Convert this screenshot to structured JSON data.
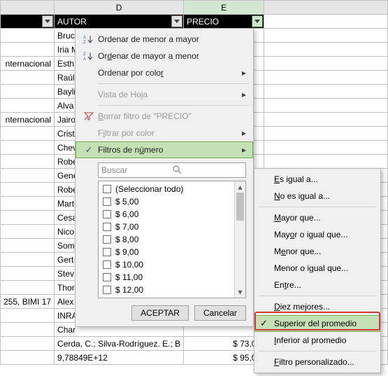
{
  "columns": {
    "c_letter": "",
    "d_letter": "D",
    "e_letter": "E"
  },
  "headers": {
    "autor": "AUTOR",
    "precio": "PRECIO"
  },
  "rows": [
    {
      "c": "",
      "d": "Bruc",
      "e": ""
    },
    {
      "c": "",
      "d": "Iria M",
      "e": ""
    },
    {
      "c": "nternacional",
      "d": "Esth",
      "e": ""
    },
    {
      "c": "",
      "d": "Raúl",
      "e": ""
    },
    {
      "c": "",
      "d": "Bayli",
      "e": ""
    },
    {
      "c": "",
      "d": "Alva",
      "e": ""
    },
    {
      "c": "nternacional",
      "d": "Jairo",
      "e": ""
    },
    {
      "c": "",
      "d": "Crist",
      "e": ""
    },
    {
      "c": "",
      "d": "Chev",
      "e": ""
    },
    {
      "c": "",
      "d": "Robe",
      "e": ""
    },
    {
      "c": "",
      "d": "Gene",
      "e": ""
    },
    {
      "c": "",
      "d": "Robe",
      "e": ""
    },
    {
      "c": "",
      "d": "Mart",
      "e": ""
    },
    {
      "c": "",
      "d": "Cesa",
      "e": ""
    },
    {
      "c": "",
      "d": "Nico",
      "e": ""
    },
    {
      "c": "",
      "d": "Som",
      "e": ""
    },
    {
      "c": "",
      "d": "Gert",
      "e": ""
    },
    {
      "c": "",
      "d": "Stev",
      "e": ""
    },
    {
      "c": "",
      "d": "Thor",
      "e": ""
    },
    {
      "c": "255, BIMI 17",
      "d": "Alex",
      "e": ""
    },
    {
      "c": "",
      "d": "INRA",
      "e": ""
    },
    {
      "c": "",
      "d": "Char",
      "e": ""
    },
    {
      "c": "",
      "d": "Cerda, C.; Silva-Rodríguez. E.; B",
      "e": "$ 73,00"
    },
    {
      "c": "",
      "d": "9,78849E+12",
      "e": "$ 95,00"
    }
  ],
  "menu": {
    "sort_asc": "Ordenar de menor a mayor",
    "sort_desc": "Ordenar de mayor a menor",
    "sort_color": "Ordenar por color",
    "sheet_view": "Vista de Hoja",
    "clear_filter": "Borrar filtro de \"PRECIO\"",
    "filter_color": "Filtrar por color",
    "number_filters": "Filtros de número",
    "search_placeholder": "Buscar",
    "select_all": "(Seleccionar todo)",
    "values": [
      "$ 5,00",
      "$ 6,00",
      "$ 7,00",
      "$ 8,00",
      "$ 9,00",
      "$ 10,00",
      "$ 11,00",
      "$ 12,00"
    ],
    "accept": "ACEPTAR",
    "cancel": "Cancelar"
  },
  "submenu": {
    "equals": "Es igual a...",
    "not_equals": "No es igual a...",
    "greater": "Mayor que...",
    "greater_eq": "Mayor o igual que...",
    "less": "Menor que...",
    "less_eq": "Menor o igual que...",
    "between": "Entre...",
    "top10": "Diez mejores...",
    "above_avg": "Superior del promedio",
    "below_avg": "Inferior al promedio",
    "custom": "Filtro personalizado..."
  }
}
